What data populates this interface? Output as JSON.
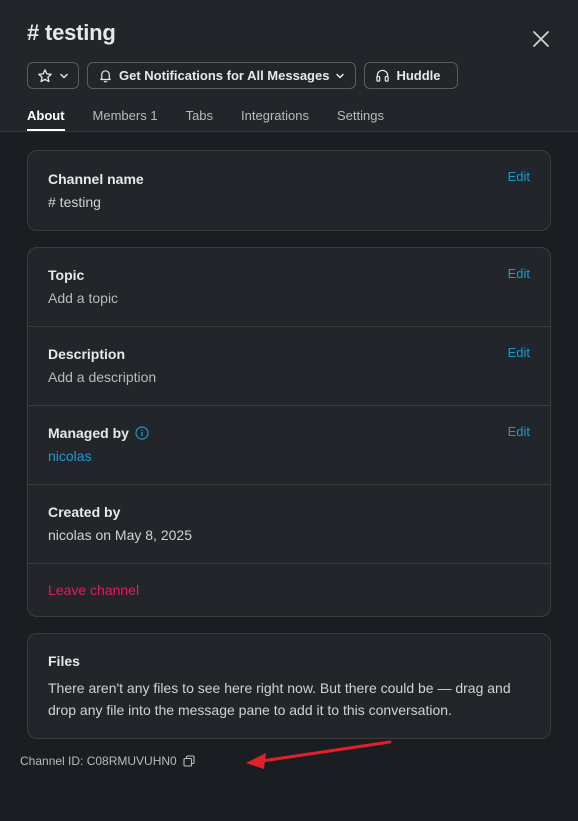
{
  "header": {
    "title": "# testing",
    "notifications_label": "Get Notifications for All Messages",
    "huddle_label": "Huddle"
  },
  "tabs": [
    {
      "label": "About",
      "active": true
    },
    {
      "label": "Members 1",
      "active": false
    },
    {
      "label": "Tabs",
      "active": false
    },
    {
      "label": "Integrations",
      "active": false
    },
    {
      "label": "Settings",
      "active": false
    }
  ],
  "about": {
    "channel_name": {
      "title": "Channel name",
      "value": "# testing",
      "edit": "Edit"
    },
    "topic": {
      "title": "Topic",
      "value": "Add a topic",
      "edit": "Edit"
    },
    "description": {
      "title": "Description",
      "value": "Add a description",
      "edit": "Edit"
    },
    "managed_by": {
      "title": "Managed by",
      "value": "nicolas",
      "edit": "Edit"
    },
    "created_by": {
      "title": "Created by",
      "value": "nicolas on May 8, 2025"
    },
    "leave_label": "Leave channel"
  },
  "files": {
    "title": "Files",
    "text": "There aren't any files to see here right now. But there could be — drag and drop any file into the message pane to add it to this conversation."
  },
  "channel_id": {
    "label": "Channel ID: C08RMUVUHN0"
  },
  "colors": {
    "background": "#1a1d21",
    "header": "#222529",
    "link": "#1d9bd1",
    "danger": "#e01e5a",
    "annotation_arrow": "#e0202a"
  },
  "icons": {
    "close": "close-icon",
    "star": "star-icon",
    "bell": "bell-icon",
    "headphones": "headphones-icon",
    "info": "info-icon",
    "copy": "copy-icon"
  }
}
